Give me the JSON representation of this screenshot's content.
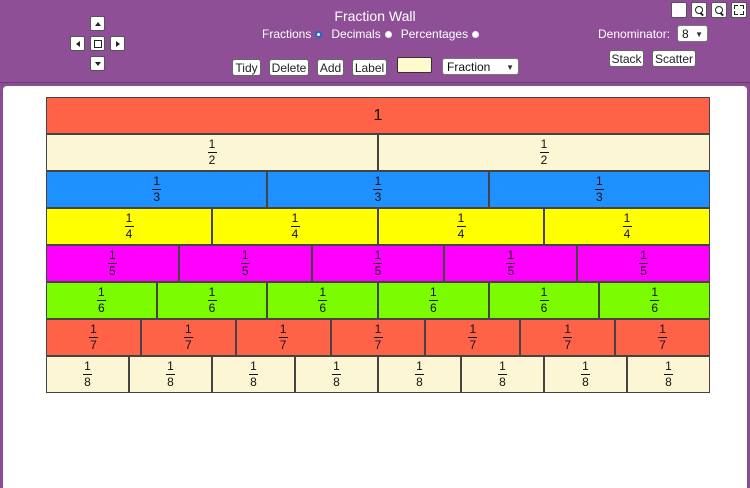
{
  "app": {
    "title": "Fraction Wall"
  },
  "nav": {
    "up_icon": "arrow-up-icon",
    "down_icon": "arrow-down-icon",
    "left_icon": "arrow-left-icon",
    "right_icon": "arrow-right-icon",
    "center_icon": "center-square-icon"
  },
  "modes": {
    "items": [
      {
        "label": "Fractions",
        "selected": true
      },
      {
        "label": "Decimals",
        "selected": false
      },
      {
        "label": "Percentages",
        "selected": false
      }
    ]
  },
  "toolbar": {
    "tidy_label": "Tidy",
    "delete_label": "Delete",
    "add_label": "Add",
    "label_label": "Label",
    "swatch_color": "#fffacd",
    "display_select": {
      "value": "Fraction"
    }
  },
  "denominator": {
    "label": "Denominator:",
    "value": "8"
  },
  "arrange": {
    "stack_label": "Stack",
    "scatter_label": "Scatter"
  },
  "corner": {
    "icons": [
      "blank-square-icon",
      "zoom-in-icon",
      "zoom-out-icon",
      "fullscreen-icon"
    ]
  },
  "colors": {
    "header_bg": "#8e4f96",
    "row1": "#ff6347",
    "row2": "#fdf6d5",
    "row3": "#1e90ff",
    "row4": "#ffff00",
    "row5": "#ff00ff",
    "row6": "#7cfc00",
    "row7": "#ff6347",
    "row8": "#fdf6d5"
  },
  "wall": {
    "rows": [
      {
        "denominator": 1,
        "tiles": [
          {
            "whole": "1"
          }
        ]
      },
      {
        "denominator": 2,
        "tiles": [
          {
            "num": "1",
            "den": "2"
          },
          {
            "num": "1",
            "den": "2"
          }
        ]
      },
      {
        "denominator": 3,
        "tiles": [
          {
            "num": "1",
            "den": "3"
          },
          {
            "num": "1",
            "den": "3"
          },
          {
            "num": "1",
            "den": "3"
          }
        ]
      },
      {
        "denominator": 4,
        "tiles": [
          {
            "num": "1",
            "den": "4"
          },
          {
            "num": "1",
            "den": "4"
          },
          {
            "num": "1",
            "den": "4"
          },
          {
            "num": "1",
            "den": "4"
          }
        ]
      },
      {
        "denominator": 5,
        "tiles": [
          {
            "num": "1",
            "den": "5"
          },
          {
            "num": "1",
            "den": "5"
          },
          {
            "num": "1",
            "den": "5"
          },
          {
            "num": "1",
            "den": "5"
          },
          {
            "num": "1",
            "den": "5"
          }
        ]
      },
      {
        "denominator": 6,
        "tiles": [
          {
            "num": "1",
            "den": "6"
          },
          {
            "num": "1",
            "den": "6"
          },
          {
            "num": "1",
            "den": "6"
          },
          {
            "num": "1",
            "den": "6"
          },
          {
            "num": "1",
            "den": "6"
          },
          {
            "num": "1",
            "den": "6"
          }
        ]
      },
      {
        "denominator": 7,
        "tiles": [
          {
            "num": "1",
            "den": "7"
          },
          {
            "num": "1",
            "den": "7"
          },
          {
            "num": "1",
            "den": "7"
          },
          {
            "num": "1",
            "den": "7"
          },
          {
            "num": "1",
            "den": "7"
          },
          {
            "num": "1",
            "den": "7"
          },
          {
            "num": "1",
            "den": "7"
          }
        ]
      },
      {
        "denominator": 8,
        "tiles": [
          {
            "num": "1",
            "den": "8"
          },
          {
            "num": "1",
            "den": "8"
          },
          {
            "num": "1",
            "den": "8"
          },
          {
            "num": "1",
            "den": "8"
          },
          {
            "num": "1",
            "den": "8"
          },
          {
            "num": "1",
            "den": "8"
          },
          {
            "num": "1",
            "den": "8"
          },
          {
            "num": "1",
            "den": "8"
          }
        ]
      }
    ]
  }
}
